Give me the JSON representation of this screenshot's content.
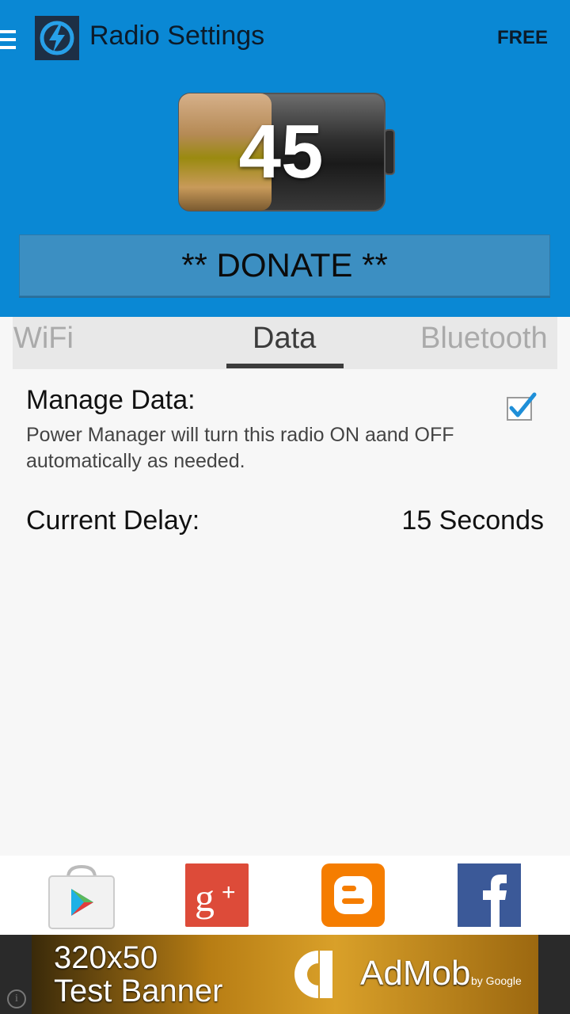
{
  "header": {
    "title": "Radio Settings",
    "badge": "FREE",
    "battery_level": "45",
    "battery_fraction": 0.45,
    "donate_label": "** DONATE **"
  },
  "tabs": [
    {
      "label": "WiFi",
      "active": false
    },
    {
      "label": "Data",
      "active": true
    },
    {
      "label": "Bluetooth",
      "active": false
    }
  ],
  "settings": {
    "manage_label": "Manage Data:",
    "manage_desc": "Power Manager will turn this radio ON aand OFF automatically as needed.",
    "manage_checked": true,
    "delay_label": "Current Delay:",
    "delay_value": "15 Seconds"
  },
  "social": [
    {
      "icon": "play-store-icon"
    },
    {
      "icon": "google-plus-icon",
      "color": "#dd4b39"
    },
    {
      "icon": "blogger-icon",
      "color": "#f57d00"
    },
    {
      "icon": "facebook-icon",
      "color": "#3b5998"
    }
  ],
  "ad": {
    "line1": "320x50",
    "line2": "Test Banner",
    "brand": "AdMob",
    "byline": "by Google"
  },
  "colors": {
    "header_bg": "#0a88d4",
    "donate_bg": "#3c8fc2"
  }
}
